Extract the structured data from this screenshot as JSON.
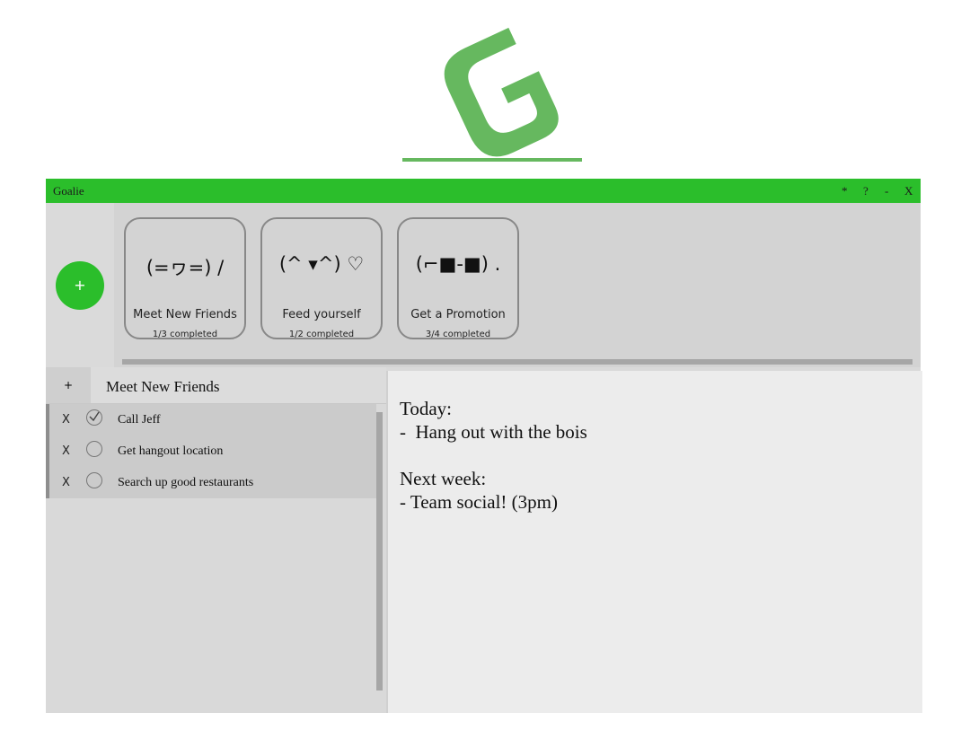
{
  "logo": {
    "letter": "G",
    "color": "#66b85f"
  },
  "window": {
    "title": "Goalie",
    "controls": [
      "*",
      "?",
      "-",
      "X"
    ],
    "accent": "#2bbe2b"
  },
  "goals": {
    "add_label": "+",
    "cards": [
      {
        "face": "(=ヮ=) /",
        "name": "Meet New Friends",
        "progress": "1/3 completed"
      },
      {
        "face": "(^ ▾^) ♡",
        "name": "Feed yourself",
        "progress": "1/2 completed"
      },
      {
        "face": "(⌐■-■) .",
        "name": "Get a Promotion",
        "progress": "3/4 completed"
      }
    ]
  },
  "task_panel": {
    "add_label": "+",
    "goal_title": "Meet New Friends",
    "delete_label": "X",
    "tasks": [
      {
        "label": "Call Jeff",
        "done": true
      },
      {
        "label": "Get hangout location",
        "done": false
      },
      {
        "label": "Search up good restaurants",
        "done": false
      }
    ]
  },
  "notes": {
    "lines": [
      "Today:",
      "-  Hang out with the bois",
      "",
      "Next week:",
      "- Team social! (3pm)"
    ]
  }
}
